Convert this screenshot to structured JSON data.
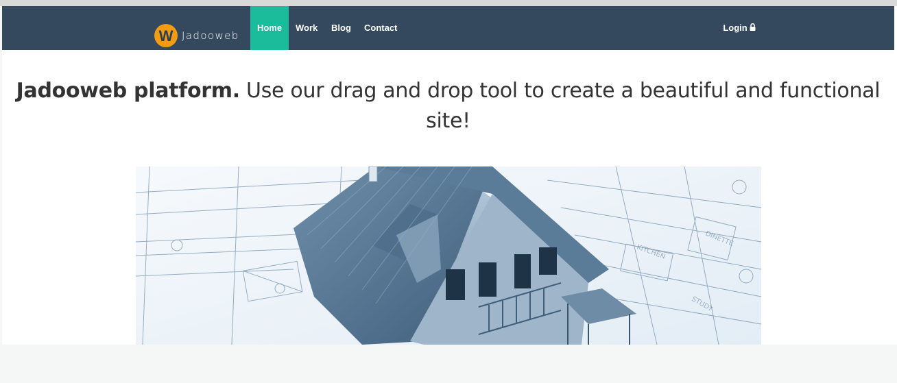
{
  "brand": {
    "name": "Jadooweb",
    "logo_letter": "W",
    "logo_color": "#f39c12"
  },
  "nav": {
    "items": [
      {
        "label": "Home",
        "active": true
      },
      {
        "label": "Work"
      },
      {
        "label": "Blog"
      },
      {
        "label": "Contact"
      }
    ],
    "login_label": "Login",
    "login_icon": "lock-icon"
  },
  "hero": {
    "headline_bold": "Jadooweb platform.",
    "headline_rest": " Use our drag and drop tool to create a beautiful and functional site!"
  },
  "colors": {
    "navbar": "#34495e",
    "active_tab": "#1abc9c",
    "text": "#333333"
  }
}
